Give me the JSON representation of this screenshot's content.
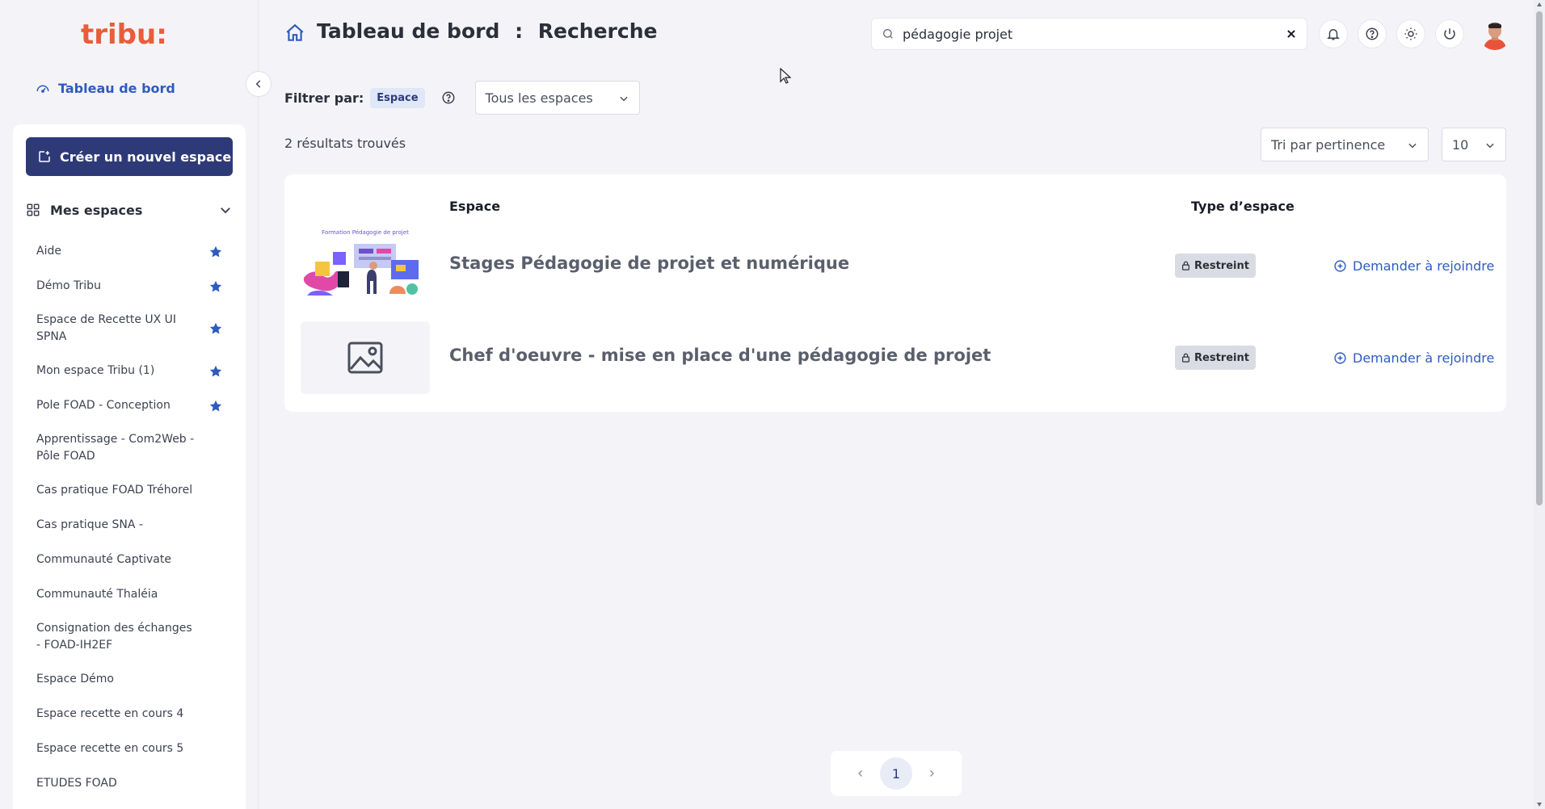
{
  "brand": {
    "logo_text": "tribu:"
  },
  "sidebar": {
    "dashboard_link": "Tableau de bord",
    "create_button": "Créer un nouvel espace",
    "my_spaces_label": "Mes espaces",
    "items": [
      {
        "label": "Aide",
        "starred": true
      },
      {
        "label": "Démo Tribu",
        "starred": true
      },
      {
        "label": "Espace de Recette UX UI SPNA",
        "starred": true
      },
      {
        "label": "Mon espace Tribu (1)",
        "starred": true
      },
      {
        "label": "Pole FOAD - Conception",
        "starred": true
      },
      {
        "label": "Apprentissage - Com2Web - Pôle FOAD",
        "starred": false
      },
      {
        "label": "Cas pratique FOAD Tréhorel",
        "starred": false
      },
      {
        "label": "Cas pratique SNA -",
        "starred": false
      },
      {
        "label": "Communauté Captivate",
        "starred": false
      },
      {
        "label": "Communauté Thaléia",
        "starred": false
      },
      {
        "label": "Consignation des échanges - FOAD-IH2EF",
        "starred": false
      },
      {
        "label": "Espace Démo",
        "starred": false
      },
      {
        "label": "Espace recette en cours 4",
        "starred": false
      },
      {
        "label": "Espace recette en cours 5",
        "starred": false
      },
      {
        "label": "ETUDES FOAD",
        "starred": false
      }
    ]
  },
  "header": {
    "title_main": "Tableau de bord",
    "title_separator": ":",
    "title_sub": "Recherche",
    "search_value": "pédagogie projet"
  },
  "filter": {
    "label": "Filtrer par:",
    "chip": "Espace",
    "scope_select": "Tous les espaces"
  },
  "results": {
    "count_text": "2 résultats trouvés",
    "sort_select": "Tri par pertinence",
    "per_page_select": "10",
    "columns": {
      "space": "Espace",
      "type": "Type d’espace"
    },
    "rows": [
      {
        "title": "Stages Pédagogie de projet et numérique",
        "type": "Restreint",
        "action": "Demander à rejoindre",
        "has_image": true,
        "image_caption": "Formation Pédagogie de projet"
      },
      {
        "title": "Chef d'oeuvre - mise en place d'une pédagogie de projet",
        "type": "Restreint",
        "action": "Demander à rejoindre",
        "has_image": false
      }
    ]
  },
  "pagination": {
    "current_page": "1"
  },
  "colors": {
    "accent": "#2f5bbf",
    "primary_button": "#2e3a78",
    "badge_bg": "#dadce3",
    "page_bg": "#f4f4f8"
  }
}
